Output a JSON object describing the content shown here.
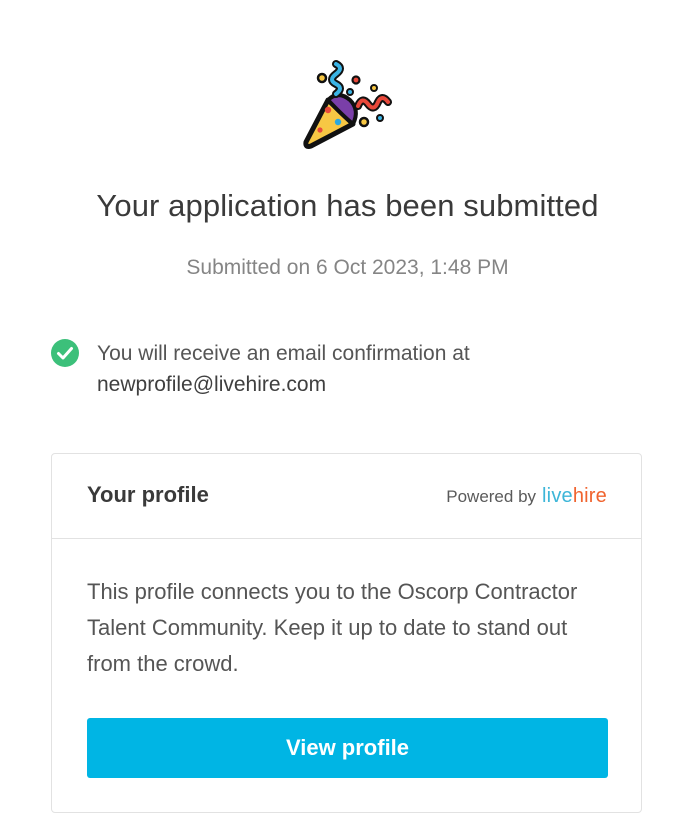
{
  "hero": {
    "icon": "party-popper-icon"
  },
  "title": "Your application has been submitted",
  "submitted_on": "Submitted on 6 Oct 2023, 1:48 PM",
  "confirmation": {
    "icon": "check-circle-icon",
    "text": "You will receive an email confirmation at",
    "email": "newprofile@livehire.com"
  },
  "card": {
    "title": "Your profile",
    "powered_by": "Powered by",
    "brand": {
      "part1": "live",
      "part2": "hire"
    },
    "body": "This profile connects you to the Oscorp Contractor Talent Community. Keep it up to date to stand out from the crowd.",
    "button_label": "View profile"
  },
  "colors": {
    "accent": "#00b5e4",
    "success": "#3cc07a",
    "brand_live": "#3db6d8",
    "brand_hire": "#f0642f"
  }
}
